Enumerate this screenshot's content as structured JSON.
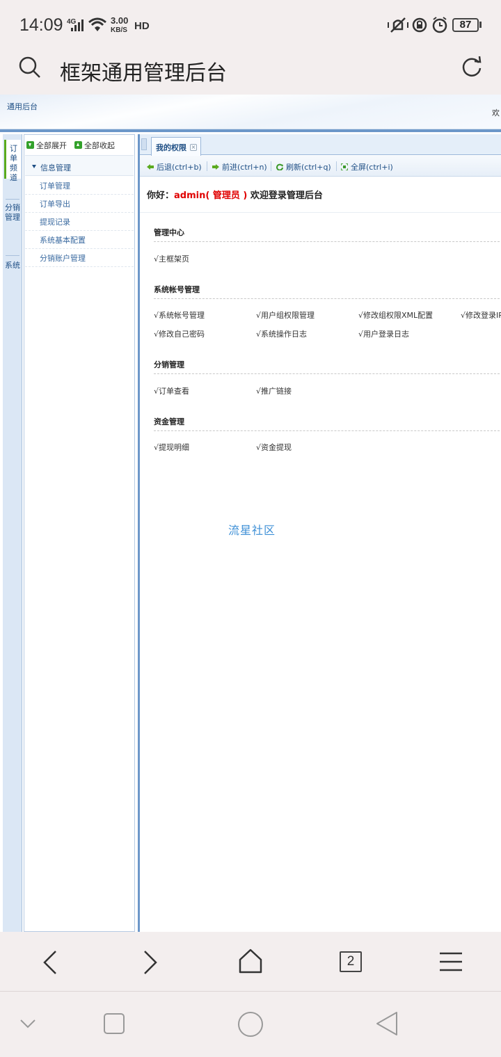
{
  "status_bar": {
    "time": "14:09",
    "network": "4G",
    "speed_value": "3.00",
    "speed_unit": "KB/S",
    "hd": "HD",
    "battery": "87"
  },
  "browser": {
    "page_title": "框架通用管理后台",
    "tab_count": "2"
  },
  "banner": {
    "title": "通用后台",
    "welcome": "欢"
  },
  "vertical_tabs": [
    {
      "label": "订单频道"
    },
    {
      "label": "分销管理"
    },
    {
      "label": "系统"
    }
  ],
  "tree": {
    "expand_all": "全部展开",
    "collapse_all": "全部收起",
    "group": "信息管理",
    "items": [
      "订单管理",
      "订单导出",
      "提现记录",
      "系统基本配置",
      "分销账户管理"
    ]
  },
  "main": {
    "tab_label": "我的权限",
    "nav": {
      "back": "后退(ctrl+b)",
      "forward": "前进(ctrl+n)",
      "refresh": "刷新(ctrl+q)",
      "fullscreen": "全屏(ctrl+i)"
    },
    "greeting": {
      "prefix": "你好：",
      "user": "admin( 管理员 )",
      "suffix": " 欢迎登录管理后台"
    },
    "sections": [
      {
        "title": "管理中心",
        "links": [
          "√主框架页"
        ]
      },
      {
        "title": "系统帐号管理",
        "links": [
          "√系统帐号管理",
          "√用户组权限管理",
          "√修改组权限XML配置",
          "√修改登录IP",
          "√修改自己密码",
          "√系统操作日志",
          "√用户登录日志"
        ]
      },
      {
        "title": "分销管理",
        "links": [
          "√订单查看",
          "√推广链接"
        ]
      },
      {
        "title": "资金管理",
        "links": [
          "√提现明细",
          "√资金提现"
        ]
      }
    ],
    "footer_link": "流星社区"
  },
  "colors": {
    "frame_blue": "#6c97c9",
    "link_blue": "#1f4f85",
    "greeting_red": "#e00000",
    "active_tab_green": "#5aaa1e",
    "community_blue": "#3d8fd6"
  }
}
